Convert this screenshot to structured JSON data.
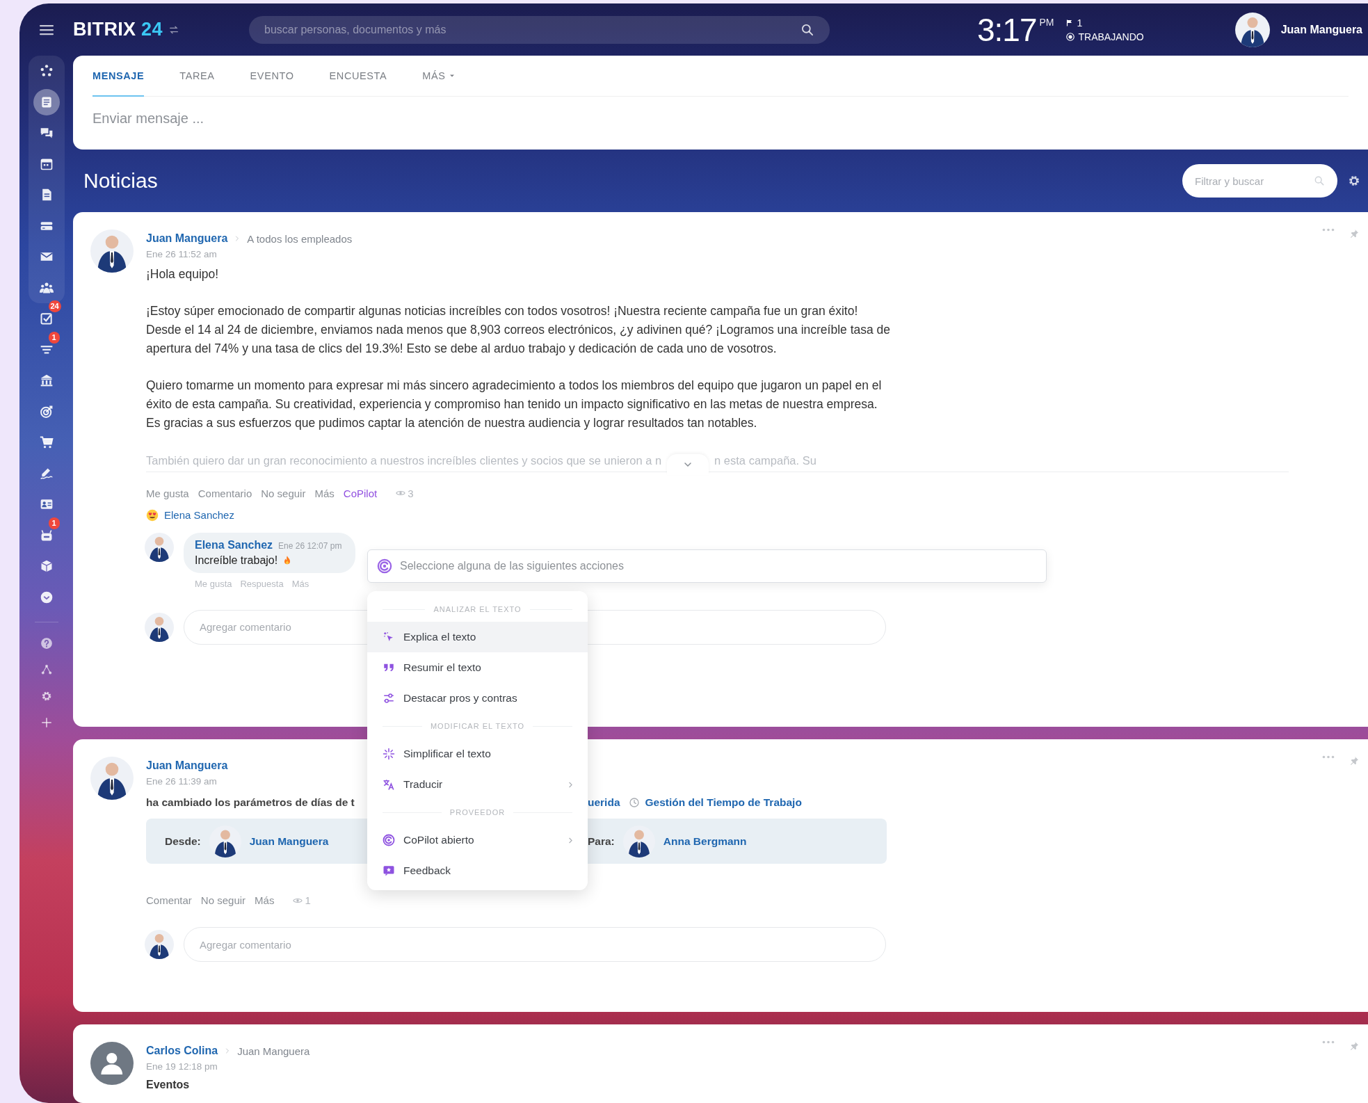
{
  "top_bar": {
    "logo": "BITRIX",
    "logo_number": "24",
    "search": {
      "placeholder": "buscar personas, documentos y más"
    },
    "clock": {
      "time": "3:17",
      "meridiem": "PM"
    },
    "flag_count": "1",
    "status": "TRABAJANDO",
    "user": {
      "name": "Juan Manguera"
    }
  },
  "sidebar": {
    "pinned": [
      {
        "selected": false
      },
      {
        "selected": true
      },
      {
        "selected": false
      },
      {
        "selected": false
      },
      {
        "selected": false
      },
      {
        "selected": false
      },
      {
        "selected": false
      },
      {
        "selected": false
      }
    ],
    "items": [
      {
        "selected": false,
        "badge": "24"
      },
      {
        "selected": false,
        "badge": "1"
      },
      {
        "selected": false
      },
      {
        "selected": false
      },
      {
        "selected": false
      },
      {
        "selected": false
      },
      {
        "selected": false
      },
      {
        "selected": false,
        "badge": "1"
      },
      {
        "selected": false
      },
      {
        "selected": false
      }
    ],
    "footer": [
      {
        "selected": false
      },
      {
        "selected": false
      },
      {
        "selected": false
      },
      {
        "selected": false
      }
    ]
  },
  "composer": {
    "tabs": [
      {
        "label": "MENSAJE",
        "selected": true,
        "dropdown": false
      },
      {
        "label": "TAREA",
        "selected": false,
        "dropdown": false
      },
      {
        "label": "EVENTO",
        "selected": false,
        "dropdown": false
      },
      {
        "label": "ENCUESTA",
        "selected": false,
        "dropdown": false
      },
      {
        "label": "MÁS",
        "selected": false,
        "dropdown": true
      }
    ],
    "message": {
      "placeholder": "Enviar mensaje ..."
    }
  },
  "feed": {
    "title": "Noticias",
    "filter": {
      "placeholder": "Filtrar y buscar"
    }
  },
  "posts": [
    {
      "kind": "message",
      "avatar": {
        "kind": "photo"
      },
      "author": "Juan Manguera",
      "recipient": "A todos los empleados",
      "date": "Ene 26 11:52 am",
      "paragraphs": [
        "¡Hola equipo!",
        "¡Estoy súper emocionado de compartir algunas noticias increíbles con todos vosotros! ¡Nuestra reciente campaña fue un gran éxito! Desde el 14 al 24 de diciembre, enviamos nada menos que 8,903 correos electrónicos, ¿y adivinen qué? ¡Logramos una increíble tasa de apertura del 74% y una tasa de clics del 19.3%! Esto se debe al arduo trabajo y dedicación de cada uno de vosotros.",
        "Quiero tomarme un momento para expresar mi más sincero agradecimiento a todos los miembros del equipo que jugaron un papel en el éxito de esta campaña. Su creatividad, experiencia y compromiso han tenido un impacto significativo en las metas de nuestra empresa. Es gracias a sus esfuerzos que pudimos captar la atención de nuestra audiencia y lograr resultados tan notables."
      ],
      "preview_cut": [
        "También quiero dar un gran reconocimiento a nuestros increíbles clientes y socios que se unieron a n",
        "n esta campaña. Su"
      ],
      "actions": [
        {
          "label": "Me gusta",
          "active": false
        },
        {
          "label": "Comentario",
          "active": false
        },
        {
          "label": "No seguir",
          "active": false
        },
        {
          "label": "Más",
          "active": false
        },
        {
          "label": "CoPilot",
          "active": true
        }
      ],
      "views": "3",
      "reactions": [
        {
          "name": "Elena Sanchez"
        }
      ],
      "comments": [
        {
          "author": "Elena Sanchez",
          "date": "Ene 26 12:07 pm",
          "text": "Increíble trabajo!",
          "actions": [
            "Me gusta",
            "Respuesta",
            "Más"
          ]
        }
      ],
      "comment_field": {
        "placeholder": "Agregar comentario"
      },
      "copilot": {
        "placeholder": "Seleccione alguna de las siguientes acciones",
        "menu": [
          {
            "kind": "header",
            "label": "ANALIZAR EL TEXTO"
          },
          {
            "kind": "item",
            "label": "Explica el texto",
            "highlighted": true,
            "submenu": false
          },
          {
            "kind": "item",
            "label": "Resumir el texto",
            "highlighted": false,
            "submenu": false
          },
          {
            "kind": "item",
            "label": "Destacar pros y contras",
            "highlighted": false,
            "submenu": false
          },
          {
            "kind": "header",
            "label": "MODIFICAR EL TEXTO"
          },
          {
            "kind": "item",
            "label": "Simplificar el texto",
            "highlighted": false,
            "submenu": false
          },
          {
            "kind": "item",
            "label": "Traducir",
            "highlighted": false,
            "submenu": true
          },
          {
            "kind": "header",
            "label": "PROVEEDOR"
          },
          {
            "kind": "item",
            "label": "CoPilot abierto",
            "highlighted": false,
            "submenu": true
          },
          {
            "kind": "item",
            "label": "Feedback",
            "highlighted": false,
            "submenu": false
          }
        ]
      }
    },
    {
      "kind": "change",
      "avatar": {
        "kind": "photo"
      },
      "author": "Juan Manguera",
      "date": "Ene 26 11:39 am",
      "change": {
        "text": "ha cambiado los parámetros de días de t",
        "target": "uerida",
        "module": "Gestión del Tiempo de Trabajo",
        "from_label": "Desde:",
        "from": "Juan Manguera",
        "to_label": "Para:",
        "to": "Anna Bergmann"
      },
      "actions": [
        {
          "label": "Comentar",
          "active": false
        },
        {
          "label": "No seguir",
          "active": false
        },
        {
          "label": "Más",
          "active": false
        }
      ],
      "views": "1",
      "comment_field": {
        "placeholder": "Agregar comentario"
      }
    },
    {
      "kind": "message",
      "avatar": {
        "kind": "placeholder"
      },
      "author": "Carlos Colina",
      "recipient": "Juan Manguera",
      "date": "Ene 19 12:18 pm",
      "title": "Eventos"
    }
  ]
}
